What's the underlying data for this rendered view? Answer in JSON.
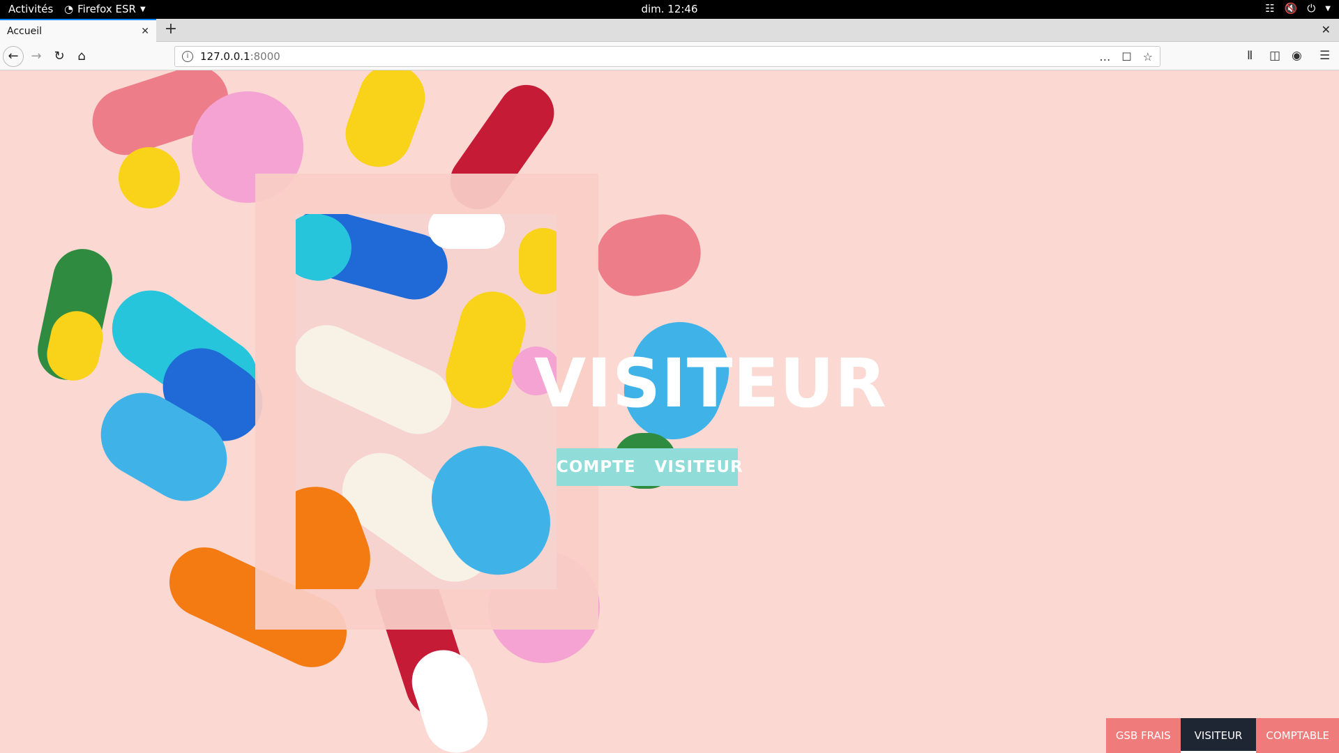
{
  "topbar": {
    "activities": "Activités",
    "app_name": "Firefox ESR",
    "clock": "dim. 12:46"
  },
  "browser": {
    "tab_title": "Accueil",
    "url_host": "127.0.0.1",
    "url_port": ":8000"
  },
  "hero": {
    "title": "VISITEUR",
    "button_label": "COMPTE   VISITEUR"
  },
  "bottom_nav": {
    "item1": "GSB FRAIS",
    "item2": "VISITEUR",
    "item3": "COMPTABLE"
  },
  "colors": {
    "background": "#fbd8d2",
    "accent_button": "#8fdcd9",
    "nav_pink": "#f07b7b",
    "nav_dark": "#1f2633"
  }
}
